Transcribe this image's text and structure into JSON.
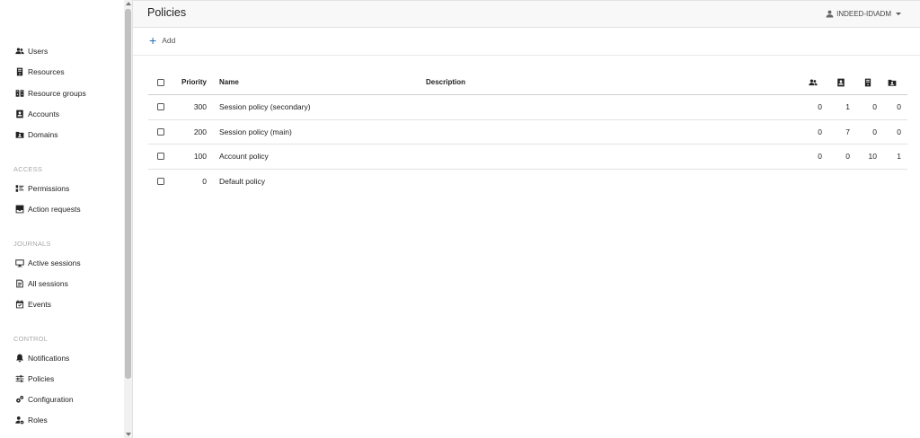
{
  "header": {
    "title": "Policies",
    "user": "INDEED-ID\\ADM"
  },
  "toolbar": {
    "add_label": "Add"
  },
  "sidebar": {
    "items": [
      {
        "label": "Users",
        "icon": "users-icon"
      },
      {
        "label": "Resources",
        "icon": "server-icon"
      },
      {
        "label": "Resource groups",
        "icon": "resource-groups-icon"
      },
      {
        "label": "Accounts",
        "icon": "account-card-icon"
      },
      {
        "label": "Domains",
        "icon": "domain-folder-icon"
      }
    ],
    "sections": [
      {
        "title": "ACCESS",
        "items": [
          {
            "label": "Permissions",
            "icon": "permissions-icon"
          },
          {
            "label": "Action requests",
            "icon": "inbox-icon"
          }
        ]
      },
      {
        "title": "JOURNALS",
        "items": [
          {
            "label": "Active sessions",
            "icon": "monitor-icon"
          },
          {
            "label": "All sessions",
            "icon": "sessions-list-icon"
          },
          {
            "label": "Events",
            "icon": "calendar-check-icon"
          }
        ]
      },
      {
        "title": "CONTROL",
        "items": [
          {
            "label": "Notifications",
            "icon": "bell-icon"
          },
          {
            "label": "Policies",
            "icon": "sliders-icon"
          },
          {
            "label": "Configuration",
            "icon": "gears-icon"
          },
          {
            "label": "Roles",
            "icon": "user-cog-icon"
          }
        ]
      }
    ]
  },
  "table": {
    "columns": {
      "priority": "Priority",
      "name": "Name",
      "description": "Description"
    },
    "count_icons": [
      "users-icon",
      "account-card-icon",
      "server-icon",
      "domain-folder-icon"
    ],
    "rows": [
      {
        "priority": "300",
        "name": "Session policy (secondary)",
        "description": "",
        "c1": "0",
        "c2": "1",
        "c3": "0",
        "c4": "0"
      },
      {
        "priority": "200",
        "name": "Session policy (main)",
        "description": "",
        "c1": "0",
        "c2": "7",
        "c3": "0",
        "c4": "0"
      },
      {
        "priority": "100",
        "name": "Account policy",
        "description": "",
        "c1": "0",
        "c2": "0",
        "c3": "10",
        "c4": "1"
      },
      {
        "priority": "0",
        "name": "Default policy",
        "description": "",
        "c1": "",
        "c2": "",
        "c3": "",
        "c4": ""
      }
    ]
  }
}
